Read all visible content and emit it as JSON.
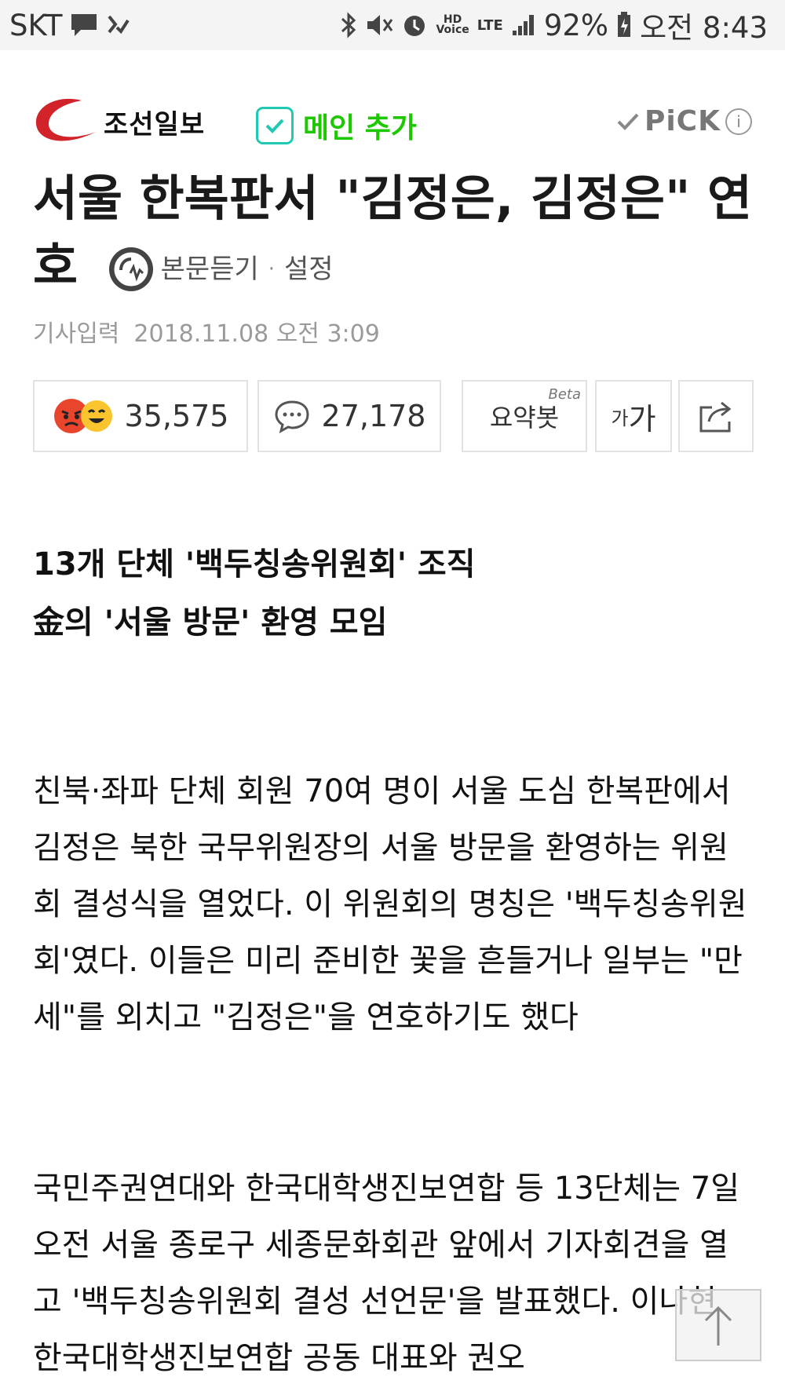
{
  "status_bar": {
    "carrier": "SKT",
    "hd_voice": "HD\nVoice",
    "lte": "LTE",
    "battery": "92%",
    "time": "오전 8:43"
  },
  "header": {
    "logo_text": "조선일보",
    "main_add_label": "메인 추가",
    "pick_label": "PiCK",
    "info_label": "i"
  },
  "article": {
    "title": "서울 한복판서 \"김정은, 김정은\" 연호",
    "listen_label": "본문듣기",
    "separator": "·",
    "settings_label": "설정",
    "date_label": "기사입력",
    "date_value": "2018.11.08 오전 3:09"
  },
  "actions": {
    "reactions_count": "35,575",
    "comments_count": "27,178",
    "summary_label": "요약봇",
    "summary_beta": "Beta",
    "font_small": "가",
    "font_large": "가"
  },
  "body": {
    "subtitle_1": "13개 단체 '백두칭송위원회' 조직",
    "subtitle_2": "金의 '서울 방문' 환영 모임",
    "paragraph_1": "친북·좌파 단체 회원 70여 명이 서울 도심 한복판에서 김정은 북한 국무위원장의 서울 방문을 환영하는 위원회 결성식을 열었다. 이 위원회의 명칭은 '백두칭송위원회'였다. 이들은 미리 준비한 꽃을 흔들거나 일부는 \"만세\"를 외치고 \"김정은\"을 연호하기도 했다",
    "paragraph_2": "국민주권연대와 한국대학생진보연합 등 13단체는 7일 오전 서울 종로구 세종문화회관 앞에서 기자회견을 열고 '백두칭송위원회 결성 선언문'을 발표했다. 이나현 한국대학생진보연합 공동 대표와 권오"
  },
  "colors": {
    "brand_red": "#d2232a",
    "main_add_green": "#1ec800",
    "check_teal": "#1fc9b2"
  }
}
